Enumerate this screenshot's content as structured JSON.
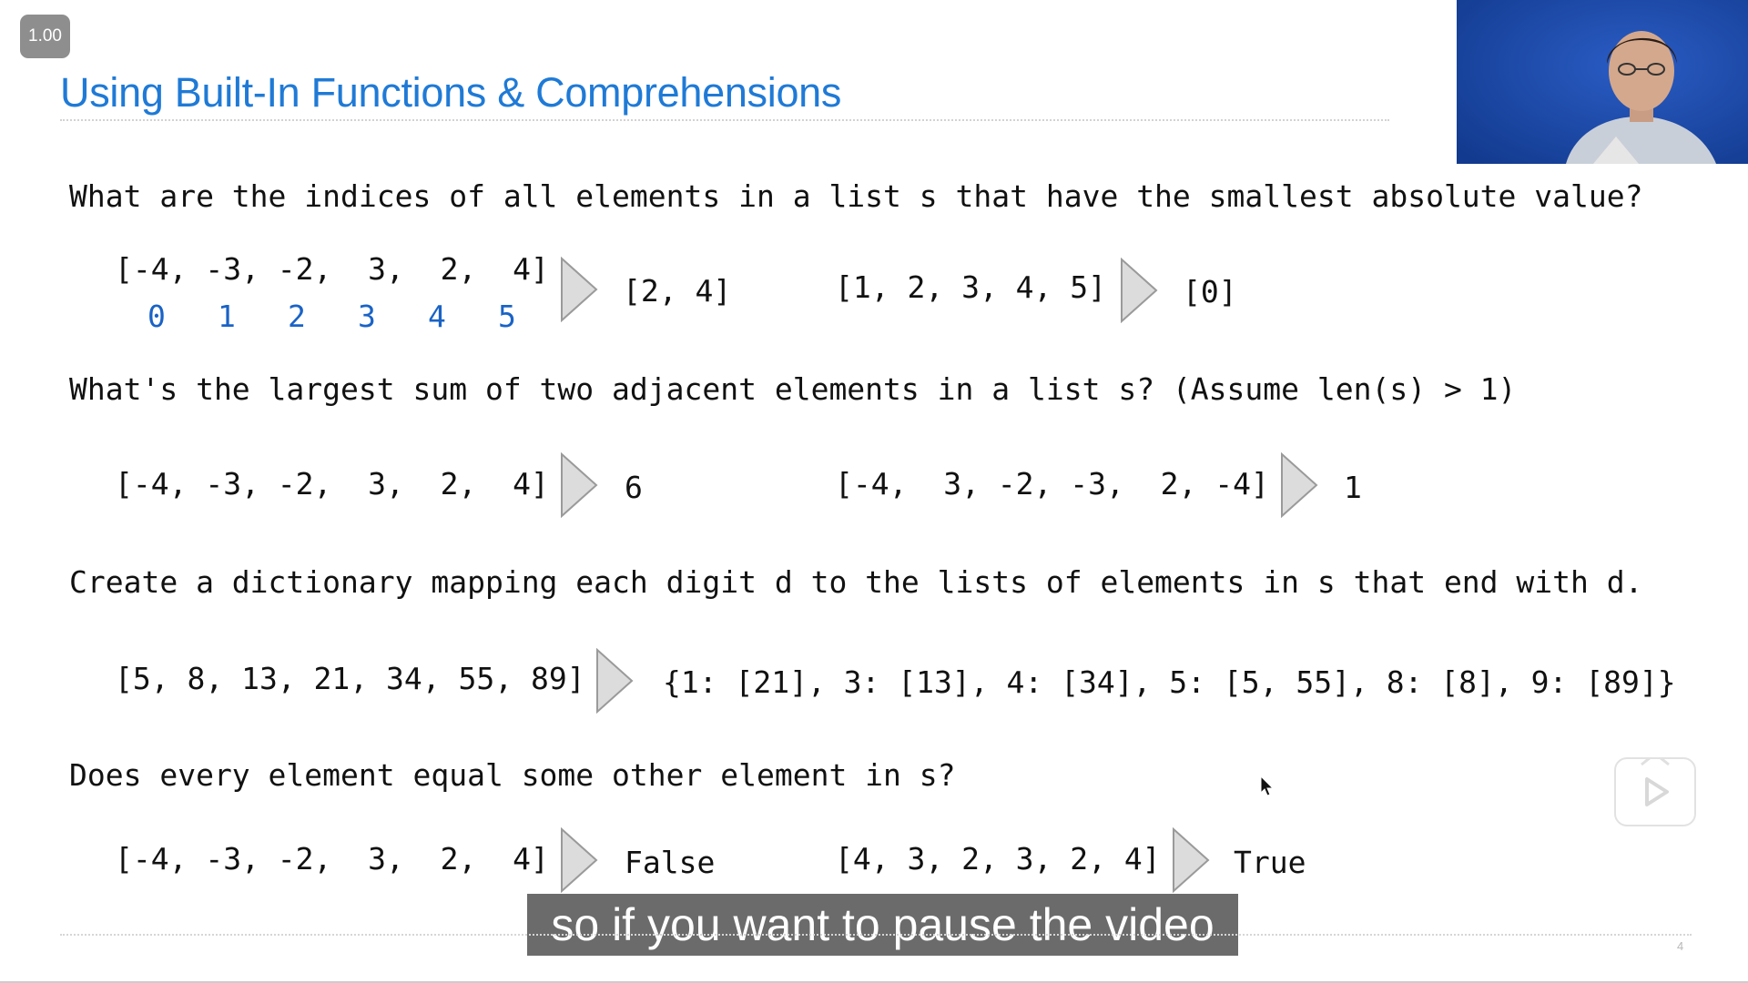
{
  "player": {
    "speed_label": "1.00",
    "caption": "so if you want to pause the video"
  },
  "slide": {
    "title": "Using Built-In Functions & Comprehensions",
    "page_number": "4",
    "q1": {
      "text": "What are the indices of all elements in a list s that have the smallest absolute value?",
      "ex1_input": "[-4, -3, -2,  3,  2,  4]",
      "indices": [
        "0",
        "1",
        "2",
        "3",
        "4",
        "5"
      ],
      "ex1_output": "[2, 4]",
      "ex2_input": "[1, 2, 3, 4, 5]",
      "ex2_output": "[0]"
    },
    "q2": {
      "text": "What's the largest sum of two adjacent elements in a list s? (Assume len(s) > 1)",
      "ex1_input": "[-4, -3, -2,  3,  2,  4]",
      "ex1_output": "6",
      "ex2_input": "[-4,  3, -2, -3,  2, -4]",
      "ex2_output": "1"
    },
    "q3": {
      "text": "Create a dictionary mapping each digit d to the lists of elements in s that end with d.",
      "ex1_input": "[5, 8, 13, 21, 34, 55, 89]",
      "ex1_output": "{1: [21], 3: [13], 4: [34], 5: [5, 55], 8: [8], 9: [89]}"
    },
    "q4": {
      "text": "Does every element equal some other element in s?",
      "ex1_input": "[-4, -3, -2,  3,  2,  4]",
      "ex1_output": "False",
      "ex2_input": "[4, 3, 2, 3, 2, 4]",
      "ex2_output": "True"
    }
  },
  "colors": {
    "title": "#1f7ad6",
    "index": "#1a63c6",
    "arrow_fill": "#dcdcdc",
    "arrow_stroke": "#9a9a9a"
  },
  "icons": {
    "arrow": "play-triangle-icon",
    "cursor": "mouse-pointer-icon",
    "play": "play-icon"
  }
}
